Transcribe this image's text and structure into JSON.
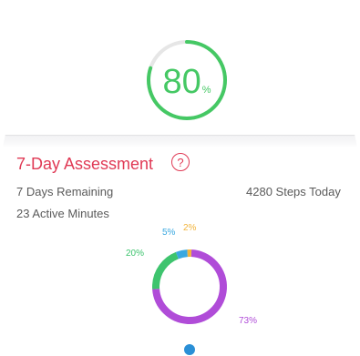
{
  "score": {
    "value": "80",
    "unit": "%",
    "progress": 0.8,
    "color": "#45c864"
  },
  "assessment": {
    "title": "7-Day Assessment",
    "help_icon": "question-circle-icon",
    "days_remaining": "7 Days Remaining",
    "steps_today": "4280 Steps Today",
    "active_minutes": "23 Active Minutes",
    "title_color": "#e03a55"
  },
  "breakdown": {
    "segments": [
      {
        "label": "73%",
        "value": 73,
        "color": "#b04cd8"
      },
      {
        "label": "20%",
        "value": 20,
        "color": "#3ec46e"
      },
      {
        "label": "5%",
        "value": 5,
        "color": "#3aa8e0"
      },
      {
        "label": "2%",
        "value": 2,
        "color": "#f2b43c"
      }
    ]
  },
  "pager": {
    "active_color": "#2a8fd6"
  }
}
